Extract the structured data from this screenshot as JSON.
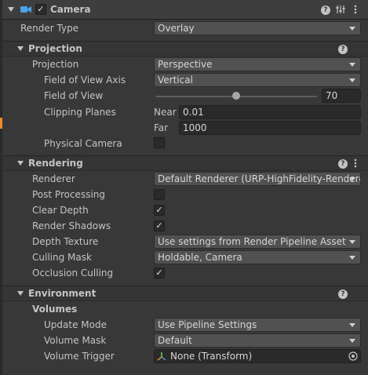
{
  "component": {
    "title": "Camera",
    "enabled": true
  },
  "render_type": {
    "label": "Render Type",
    "value": "Overlay"
  },
  "projection": {
    "title": "Projection",
    "projection_label": "Projection",
    "projection_value": "Perspective",
    "fov_axis_label": "Field of View Axis",
    "fov_axis_value": "Vertical",
    "fov_label": "Field of View",
    "fov_value": "70",
    "fov_slider_fraction": 0.5,
    "clipping_label": "Clipping Planes",
    "near_label": "Near",
    "near_value": "0.01",
    "far_label": "Far",
    "far_value": "1000",
    "physical_label": "Physical Camera",
    "physical_checked": false
  },
  "rendering": {
    "title": "Rendering",
    "renderer_label": "Renderer",
    "renderer_value": "Default Renderer (URP-HighFidelity-Renderer)",
    "post_label": "Post Processing",
    "post_checked": false,
    "clear_depth_label": "Clear Depth",
    "clear_depth_checked": true,
    "shadows_label": "Render Shadows",
    "shadows_checked": true,
    "depth_texture_label": "Depth Texture",
    "depth_texture_value": "Use settings from Render Pipeline Asset",
    "culling_label": "Culling Mask",
    "culling_value": "Holdable, Camera",
    "occlusion_label": "Occlusion Culling",
    "occlusion_checked": true
  },
  "environment": {
    "title": "Environment",
    "volumes_label": "Volumes",
    "update_mode_label": "Update Mode",
    "update_mode_value": "Use Pipeline Settings",
    "volume_mask_label": "Volume Mask",
    "volume_mask_value": "Default",
    "volume_trigger_label": "Volume Trigger",
    "volume_trigger_value": "None (Transform)"
  },
  "icons": {
    "check": "✓",
    "help": "?",
    "kebab": "⋮",
    "camera": "camera-icon",
    "presets": "presets-icon",
    "transform": "transform-icon",
    "object_picker": "object-picker-icon"
  },
  "colors": {
    "background": "#383838",
    "camera_icon": "#4aa3e8",
    "selection_accent": "#f08a2c"
  }
}
